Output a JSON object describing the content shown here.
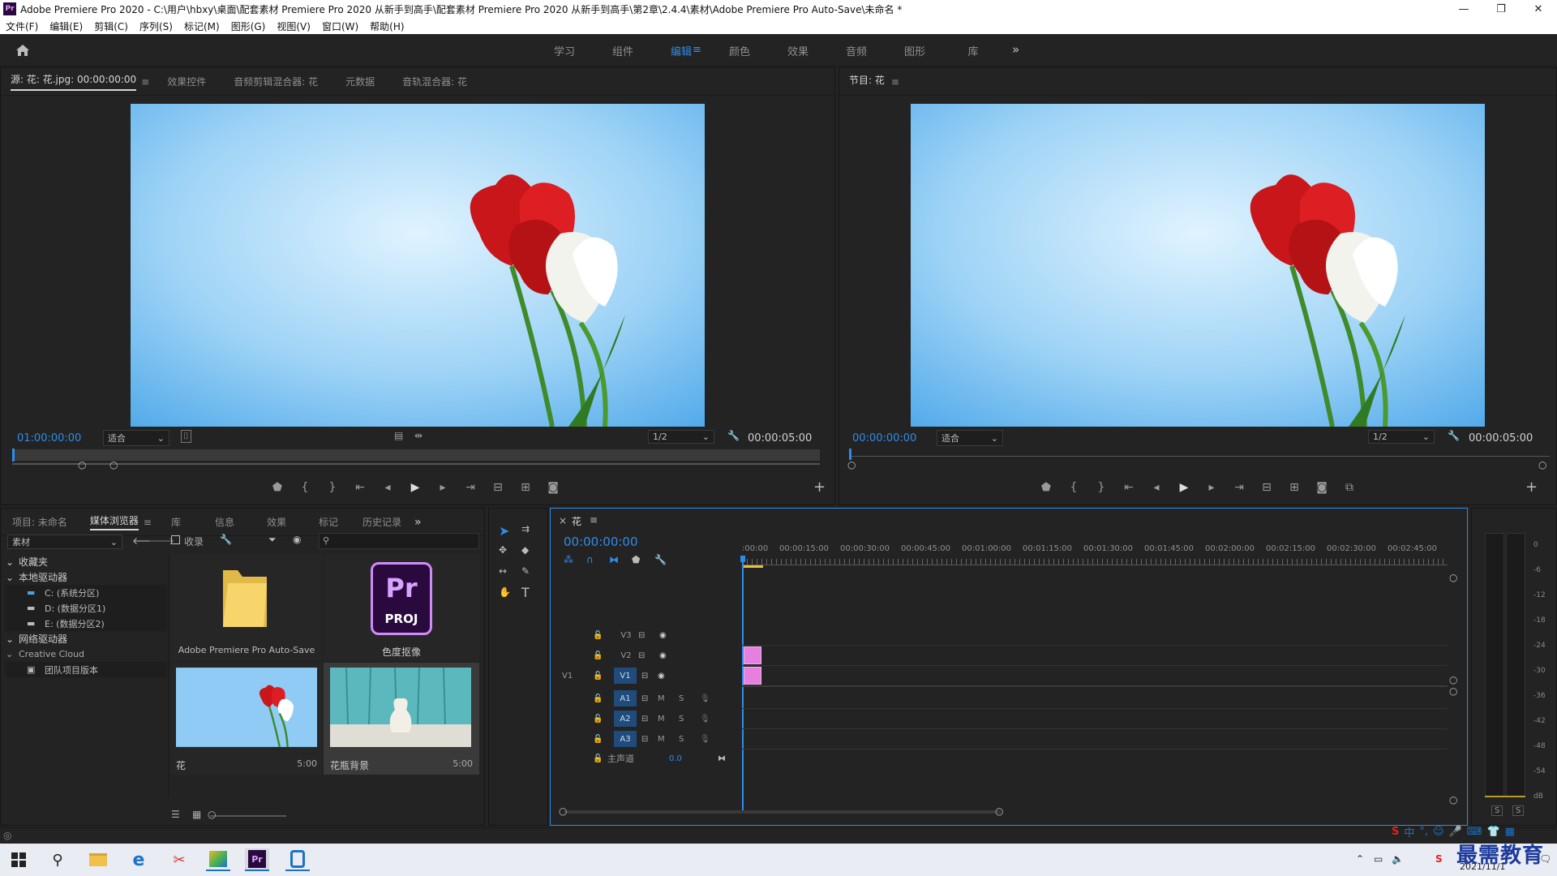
{
  "window": {
    "title": "Adobe Premiere Pro 2020 - C:\\用户\\hbxy\\桌面\\配套素材 Premiere Pro 2020 从新手到高手\\配套素材 Premiere Pro 2020 从新手到高手\\第2章\\2.4.4\\素材\\Adobe Premiere Pro Auto-Save\\未命名 *",
    "app_icon": "Pr",
    "minimize": "—",
    "maximize": "❐",
    "close": "✕"
  },
  "menu": [
    "文件(F)",
    "编辑(E)",
    "剪辑(C)",
    "序列(S)",
    "标记(M)",
    "图形(G)",
    "视图(V)",
    "窗口(W)",
    "帮助(H)"
  ],
  "workspaces": {
    "items": [
      "学习",
      "组件",
      "编辑",
      "颜色",
      "效果",
      "音频",
      "图形",
      "库"
    ],
    "active": "编辑",
    "more": "»",
    "menu_icon": "≡"
  },
  "source": {
    "tabs": [
      "源: 花: 花.jpg: 00:00:00:00",
      "效果控件",
      "音频剪辑混合器: 花",
      "元数据",
      "音轨混合器: 花"
    ],
    "tab_menu": "≡",
    "timecode": "01:00:00:00",
    "fit": "适合",
    "resolution": "1/2",
    "duration": "00:00:05:00"
  },
  "program": {
    "tab": "节目: 花",
    "tab_menu": "≡",
    "timecode": "00:00:00:00",
    "fit": "适合",
    "resolution": "1/2",
    "duration": "00:00:05:00"
  },
  "project": {
    "tabs": [
      "项目: 未命名",
      "媒体浏览器",
      "库",
      "信息",
      "效果",
      "标记",
      "历史记录"
    ],
    "active": "媒体浏览器",
    "more": "»",
    "filter_dropdown": "素材",
    "ingest_label": "收录",
    "search_placeholder": "",
    "tree": [
      {
        "label": "收藏夹",
        "level": 0
      },
      {
        "label": "本地驱动器",
        "level": 0
      },
      {
        "label": "C: (系统分区)",
        "level": 1
      },
      {
        "label": "D: (数据分区1)",
        "level": 1
      },
      {
        "label": "E: (数据分区2)",
        "level": 1
      },
      {
        "label": "网络驱动器",
        "level": 0
      },
      {
        "label": "Creative Cloud",
        "level": 0
      },
      {
        "label": "团队项目版本",
        "level": 1
      }
    ],
    "items": [
      {
        "name": "Adobe Premiere Pro Auto-Save",
        "type": "folder"
      },
      {
        "name": "色度抠像",
        "type": "proj",
        "badge1": "Pr",
        "badge2": "PROJ"
      },
      {
        "name": "花",
        "type": "image",
        "duration": "5:00"
      },
      {
        "name": "花瓶背景",
        "type": "image",
        "duration": "5:00"
      }
    ]
  },
  "timeline": {
    "tab": "花",
    "close": "×",
    "menu": "≡",
    "timecode": "00:00:00:00",
    "ruler": [
      ":00:00",
      "00:00:15:00",
      "00:00:30:00",
      "00:00:45:00",
      "00:01:00:00",
      "00:01:15:00",
      "00:01:30:00",
      "00:01:45:00",
      "00:02:00:00",
      "00:02:15:00",
      "00:02:30:00",
      "00:02:45:00"
    ],
    "video_tracks": [
      {
        "name": "V3",
        "source": ""
      },
      {
        "name": "V2",
        "source": ""
      },
      {
        "name": "V1",
        "source": "V1"
      }
    ],
    "audio_tracks": [
      "A1",
      "A2",
      "A3"
    ],
    "m": "M",
    "s": "S",
    "master": "主声道",
    "master_value": "0.0",
    "clip_color": "#e57fe0"
  },
  "meter": {
    "labels": [
      "0",
      "-6",
      "-12",
      "-18",
      "-24",
      "-30",
      "-36",
      "-42",
      "-48",
      "-54",
      "dB"
    ],
    "solo": [
      "S",
      "S"
    ]
  },
  "taskbar": {
    "time": "",
    "date": "2021/11/1",
    "ime": "中",
    "watermark": "最需教育"
  }
}
